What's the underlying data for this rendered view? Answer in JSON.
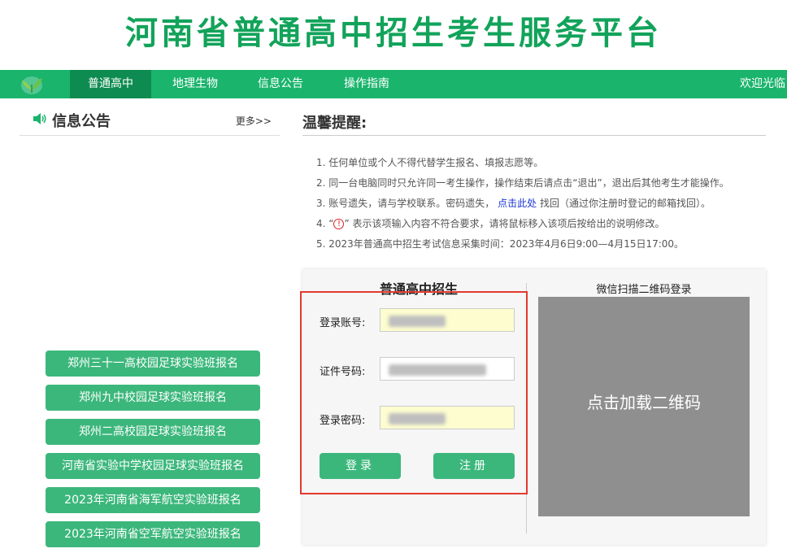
{
  "site": {
    "title": "河南省普通高中招生考生服务平台"
  },
  "nav": {
    "items": [
      "普通高中",
      "地理生物",
      "信息公告",
      "操作指南"
    ],
    "welcome": "欢迎光临"
  },
  "notice": {
    "title": "信息公告",
    "more": "更多>>",
    "buttons": [
      "郑州三十一高校园足球实验班报名",
      "郑州九中校园足球实验班报名",
      "郑州二高校园足球实验班报名",
      "河南省实验中学校园足球实验班报名",
      "2023年河南省海军航空实验班报名",
      "2023年河南省空军航空实验班报名"
    ]
  },
  "tips": {
    "title": "温馨提醒:",
    "t1": "1. 任何单位或个人不得代替学生报名、填报志愿等。",
    "t2": "2. 同一台电脑同时只允许同一考生操作，操作结束后请点击“退出”，退出后其他考生才能操作。",
    "t3_pre": "3. 账号遗失，请与学校联系。密码遗失，",
    "t3_link": "点击此处",
    "t3_post": "找回（通过你注册时登记的邮箱找回）。",
    "t4_pre": "4.  “",
    "t4_icon": "!",
    "t4_post": "”  表示该项输入内容不符合要求，请将鼠标移入该项后按给出的说明修改。",
    "t5": "5. 2023年普通高中招生考试信息采集时间：2023年4月6日9:00—4月15日17:00。"
  },
  "login": {
    "title": "普通高中招生",
    "account_label": "登录账号:",
    "id_label": "证件号码:",
    "password_label": "登录密码:",
    "login_button": "登录",
    "register_button": "注册"
  },
  "qr": {
    "title": "微信扫描二维码登录",
    "load_text": "点击加载二维码"
  },
  "colors": {
    "brand": "#1ab46c",
    "nav_active": "#0e8b50",
    "button": "#3cb77c",
    "highlight": "#e33a2e"
  }
}
